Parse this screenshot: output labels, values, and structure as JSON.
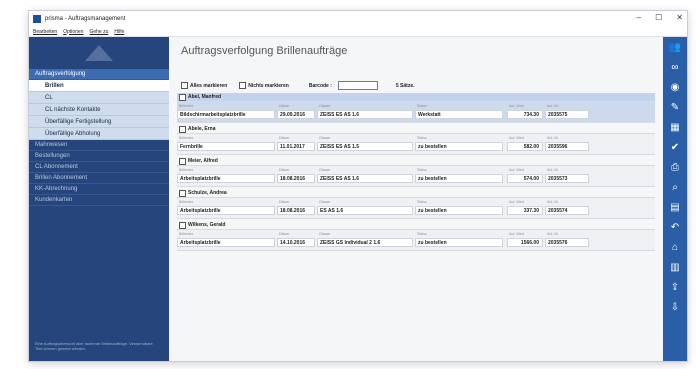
{
  "window": {
    "title": "prisma - Auftragsmanagement",
    "controls": [
      "–",
      "☐",
      "✕"
    ]
  },
  "menu": [
    "Bearbeiten",
    "Optionen",
    "Gehe zu",
    "Hilfe"
  ],
  "sidebar": {
    "groups": [
      {
        "label": "Auftragsverfolgung",
        "active": true
      },
      {
        "label": "Mahnwesen"
      },
      {
        "label": "Bestellungen"
      },
      {
        "label": "CL Abonnement"
      },
      {
        "label": "Brillen Abonnement"
      },
      {
        "label": "KK-Abrechnung"
      },
      {
        "label": "Kundenkarten"
      }
    ],
    "subitems": [
      "Brillen",
      "CL",
      "CL nächste Kontakte",
      "Überfällige Fertigstellung",
      "Überfällige Abholung"
    ],
    "note": "Eine Auftragsübersicht aller laufende Brillenaufträge. Verwendbare Titel können gesetzt werden."
  },
  "main": {
    "title": "Auftragsverfolgung Brillenaufträge",
    "toolbar": {
      "select_all": "Alles markieren",
      "select_none": "Nichts markieren",
      "barcode_label": "Barcode :",
      "barcode_value": "",
      "count": "5 Sätze."
    },
    "field_labels": {
      "item": "Brillenart",
      "date": "Datum",
      "glass": "Glasart",
      "status": "Status",
      "value": "Auf.-Wert",
      "number": "Auf.-Nr."
    },
    "orders": [
      {
        "customer": "Abel, Manfred",
        "item": "Bildschirmarbeitsplatzbrille",
        "date": "29.09.2016",
        "glass": "ZEISS ES AS 1.6",
        "status": "Werkstatt",
        "value": "734.30",
        "number": "2035575",
        "highlight": true
      },
      {
        "customer": "Abele, Erna",
        "item": "Fernbrille",
        "date": "11.01.2017",
        "glass": "ZEISS ES AS 1.5",
        "status": "zu bestellen",
        "value": "582.00",
        "number": "2035596"
      },
      {
        "customer": "Meier, Alfred",
        "item": "Arbeitsplatzbrille",
        "date": "18.08.2016",
        "glass": "ZEISS ES AS 1.6",
        "status": "zu bestellen",
        "value": "574.00",
        "number": "2035573"
      },
      {
        "customer": "Schulze, Andrea",
        "item": "Arbeitsplatzbrille",
        "date": "18.08.2016",
        "glass": "ES AS 1.6",
        "status": "zu bestellen",
        "value": "337.30",
        "number": "2035574"
      },
      {
        "customer": "Wilkens, Gerald",
        "item": "Arbeitsplatzbrille",
        "date": "14.10.2016",
        "glass": "ZEISS GS Individual 2 1.6",
        "status": "zu bestellen",
        "value": "1566.00",
        "number": "2035576"
      }
    ]
  },
  "rightbar": {
    "icons": [
      {
        "name": "people-icon",
        "glyph": "👥"
      },
      {
        "name": "glasses-icon",
        "glyph": "∞"
      },
      {
        "name": "eye-icon",
        "glyph": "◉"
      },
      {
        "name": "edit-icon",
        "glyph": "✎"
      },
      {
        "name": "calculator-icon",
        "glyph": "▦"
      },
      {
        "name": "check-icon",
        "glyph": "✔"
      },
      {
        "name": "print-icon",
        "glyph": "⎙"
      },
      {
        "name": "search-icon",
        "glyph": "⌕"
      },
      {
        "name": "document-icon",
        "glyph": "▤"
      },
      {
        "name": "back-icon",
        "glyph": "↶"
      },
      {
        "name": "home-icon",
        "glyph": "⌂"
      },
      {
        "name": "calendar-icon",
        "glyph": "▥"
      },
      {
        "name": "export-icon",
        "glyph": "⇪"
      },
      {
        "name": "import-icon",
        "glyph": "⇩"
      }
    ]
  }
}
